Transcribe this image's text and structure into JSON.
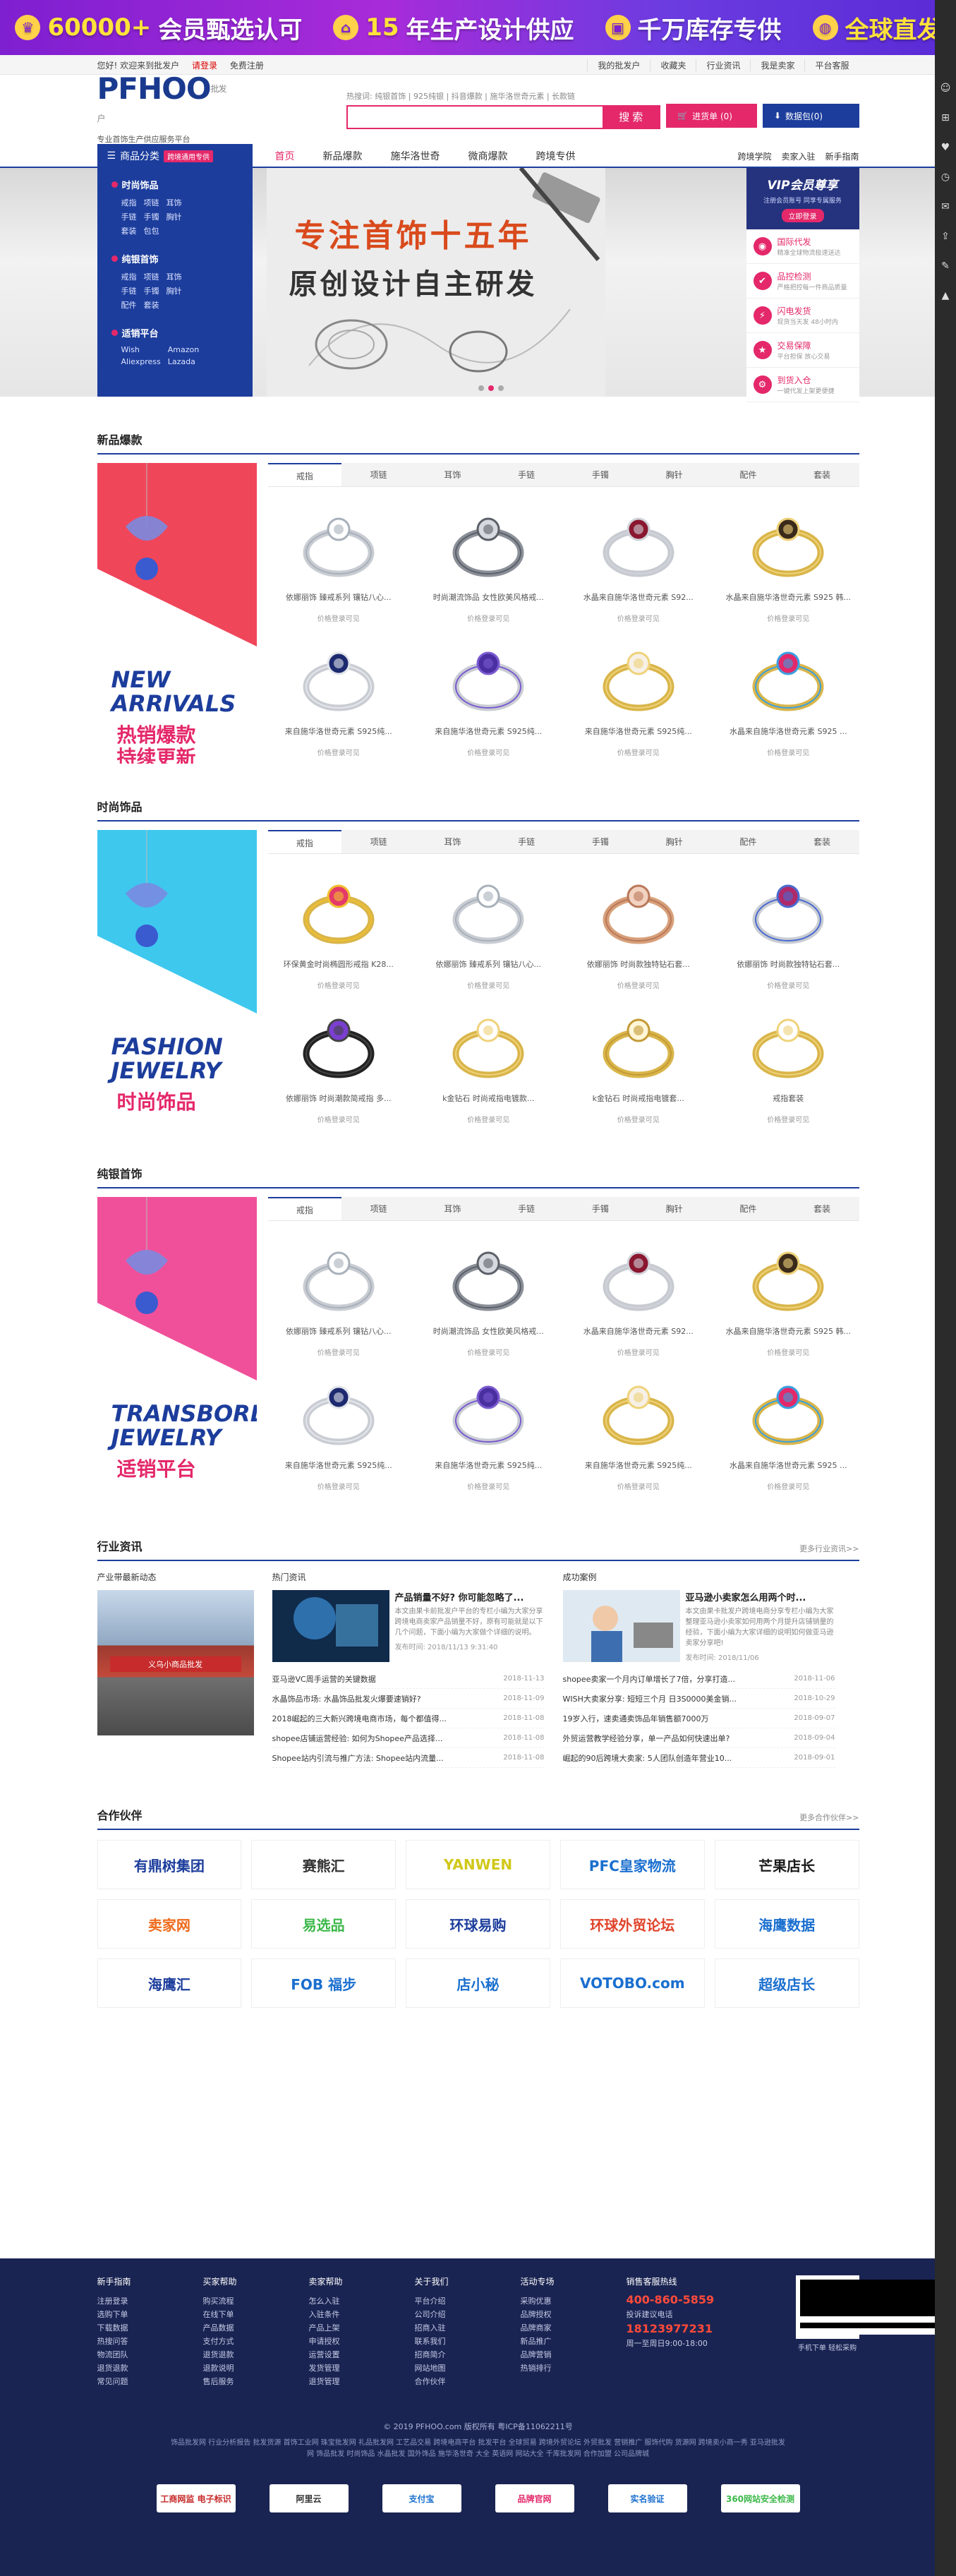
{
  "topbanner": {
    "items": [
      {
        "pre": "",
        "num": "60000+",
        "text": "会员甄选认可"
      },
      {
        "pre": "",
        "num": "15",
        "text": "年生产设计供应"
      },
      {
        "pre": "",
        "num": "",
        "text": "千万库存专供"
      },
      {
        "pre": "",
        "num": "",
        "text": "全球直发"
      }
    ]
  },
  "util": {
    "greeting": "您好! 欢迎来到批发户",
    "login": "请登录",
    "register": "免费注册",
    "right": [
      "我的批发户",
      "收藏夹",
      "行业资讯",
      "我是卖家",
      "平台客服"
    ]
  },
  "logo": {
    "main": "PFHOO",
    "cn": "批发户",
    "com": ".com",
    "sub": "专业首饰生产供应服务平台"
  },
  "search": {
    "hot": "热搜词: 纯银首饰 | 925纯银 | 抖音爆款 | 施华洛世奇元素 | 长款链",
    "placeholder": "",
    "button": "搜 索",
    "cart": "进货单 (0)",
    "data": "数据包(0)"
  },
  "nav": {
    "cat_label": "商品分类",
    "cat_tag": "跨境通用专供",
    "items": [
      "首页",
      "新品爆款",
      "施华洛世奇",
      "微商爆款",
      "跨境专供"
    ],
    "right": [
      "跨境学院",
      "卖家入驻",
      "新手指南"
    ]
  },
  "catmenu": [
    {
      "title": "时尚饰品",
      "links": [
        "戒指",
        "项链",
        "耳饰",
        "手链",
        "手镯",
        "胸针",
        "套装",
        "包包"
      ]
    },
    {
      "title": "纯银首饰",
      "links": [
        "戒指",
        "项链",
        "耳饰",
        "手链",
        "手镯",
        "胸针",
        "配件",
        "套装"
      ]
    },
    {
      "title": "适销平台",
      "links": [
        "Wish",
        "Amazon",
        "Aliexpress",
        "Lazada"
      ]
    }
  ],
  "hero": {
    "line1": "专注首饰十五年",
    "line2": "原创设计自主研发"
  },
  "vip": {
    "title": "VIP会员尊享",
    "sub": "注册会员账号 同享专属服务",
    "btn": "立即登录",
    "items": [
      {
        "icon": "globe-icon",
        "glyph": "◉",
        "title": "国际代发",
        "desc": "精准全球物流极速送达"
      },
      {
        "icon": "shield-icon",
        "glyph": "✔",
        "title": "品控检测",
        "desc": "严格把控每一件商品质量"
      },
      {
        "icon": "bolt-icon",
        "glyph": "⚡",
        "title": "闪电发货",
        "desc": "现货当天发 48小时内"
      },
      {
        "icon": "star-icon",
        "glyph": "★",
        "title": "交易保障",
        "desc": "平台担保 放心交易"
      },
      {
        "icon": "tool-icon",
        "glyph": "⚙",
        "title": "到货入仓",
        "desc": "一键代发上架更便捷"
      }
    ]
  },
  "sections": [
    {
      "title": "新品爆款",
      "promo": {
        "line1": "NEW\nARRIVALS",
        "line2": "热销爆款\n持续更新",
        "bg1": "#ffffff",
        "bg2": "#f0465a",
        "accent": "#e4286a"
      },
      "tabs": [
        "戒指",
        "项链",
        "耳饰",
        "手链",
        "手镯",
        "胸针",
        "配件",
        "套装"
      ],
      "products": [
        {
          "name": "依娜丽饰 臻戒系列 镶钻八心...",
          "price": "价格登录可见",
          "kind": "silver-cz"
        },
        {
          "name": "时尚潮流饰品 女性欧美风格戒...",
          "price": "价格登录可见",
          "kind": "silver-band"
        },
        {
          "name": "水晶来自施华洛世奇元素 S92...",
          "price": "价格登录可见",
          "kind": "ruby"
        },
        {
          "name": "水晶来自施华洛世奇元素 S925 韩...",
          "price": "价格登录可见",
          "kind": "gold-open"
        },
        {
          "name": "来自施华洛世奇元素 S925纯...",
          "price": "价格登录可见",
          "kind": "silver-pair"
        },
        {
          "name": "来自施华洛世奇元素 S925纯...",
          "price": "价格登录可见",
          "kind": "purple-flower"
        },
        {
          "name": "来自施华洛世奇元素 S925纯...",
          "price": "价格登录可见",
          "kind": "gold-pearl"
        },
        {
          "name": "水晶来自施华洛世奇元素 S925 ...",
          "price": "价格登录可见",
          "kind": "rainbow"
        }
      ]
    },
    {
      "title": "时尚饰品",
      "promo": {
        "line1": "FASHION\nJEWELRY",
        "line2": "时尚饰品",
        "bg1": "#ffffff",
        "bg2": "#3ec8ee",
        "accent": "#e4286a"
      },
      "tabs": [
        "戒指",
        "项链",
        "耳饰",
        "手链",
        "手镯",
        "胸针",
        "配件",
        "套装"
      ],
      "products": [
        {
          "name": "环保黄金时尚椭圆形戒指 K28...",
          "price": "价格登录可见",
          "kind": "multi-color"
        },
        {
          "name": "依娜丽饰 臻戒系列 镶钻八心...",
          "price": "价格登录可见",
          "kind": "silver-cz"
        },
        {
          "name": "依娜丽饰 时尚款独特钻石套...",
          "price": "价格登录可见",
          "kind": "rosegold-set"
        },
        {
          "name": "依娜丽饰 时尚款独特钻石套...",
          "price": "价格登录可见",
          "kind": "color-set"
        },
        {
          "name": "依娜丽饰 时尚潮款简戒指 多...",
          "price": "价格登录可见",
          "kind": "purple-black"
        },
        {
          "name": "k金钻石 时尚戒指电镀款...",
          "price": "价格登录可见",
          "kind": "gold-halo"
        },
        {
          "name": "k金钻石 时尚戒指电镀套...",
          "price": "价格登录可见",
          "kind": "gold-eternity"
        },
        {
          "name": "戒指套装",
          "price": "价格登录可见",
          "kind": "gold-solitaire"
        }
      ]
    },
    {
      "title": "纯银首饰",
      "promo": {
        "line1": "TRANSBORDER\nJEWELRY",
        "line2": "适销平台",
        "bg1": "#ffffff",
        "bg2": "#f0509a",
        "accent": "#e4286a"
      },
      "tabs": [
        "戒指",
        "项链",
        "耳饰",
        "手链",
        "手镯",
        "胸针",
        "配件",
        "套装"
      ],
      "products": [
        {
          "name": "依娜丽饰 臻戒系列 镶钻八心...",
          "price": "价格登录可见",
          "kind": "silver-cz"
        },
        {
          "name": "时尚潮流饰品 女性欧美风格戒...",
          "price": "价格登录可见",
          "kind": "silver-band"
        },
        {
          "name": "水晶来自施华洛世奇元素 S92...",
          "price": "价格登录可见",
          "kind": "ruby"
        },
        {
          "name": "水晶来自施华洛世奇元素 S925 韩...",
          "price": "价格登录可见",
          "kind": "gold-open"
        },
        {
          "name": "来自施华洛世奇元素 S925纯...",
          "price": "价格登录可见",
          "kind": "silver-pair"
        },
        {
          "name": "来自施华洛世奇元素 S925纯...",
          "price": "价格登录可见",
          "kind": "purple-flower"
        },
        {
          "name": "来自施华洛世奇元素 S925纯...",
          "price": "价格登录可见",
          "kind": "gold-pearl"
        },
        {
          "name": "水晶来自施华洛世奇元素 S925 ...",
          "price": "价格登录可见",
          "kind": "rainbow"
        }
      ]
    }
  ],
  "news": {
    "title": "行业资讯",
    "more": "更多行业资讯>>",
    "col1": {
      "h": "产业带最新动态",
      "sign": "义乌小商品批发"
    },
    "col2": {
      "h": "热门资讯",
      "feat": {
        "title": "产品销量不好? 你可能忽略了...",
        "desc": "本文由果卡前批发户平台的专栏小编为大家分享跨境电商卖家产品销量不好，原有可能就是以下几个问题，下面小编为大家做个详细的说明。",
        "date": "发布时间: 2018/11/13 9:31:40"
      },
      "list": [
        {
          "t": "亚马逊VC周手运营的关键数据",
          "d": "2018-11-13"
        },
        {
          "t": "水晶饰品市场: 水晶饰品批发火爆要速销好?",
          "d": "2018-11-09"
        },
        {
          "t": "2018崛起的三大新兴跨境电商市场，每个都值得...",
          "d": "2018-11-08"
        },
        {
          "t": "shopee店铺运营经验: 如何为Shopee产品选择...",
          "d": "2018-11-08"
        },
        {
          "t": "Shopee站内引流与推广方法: Shopee站内流量...",
          "d": "2018-11-08"
        }
      ]
    },
    "col3": {
      "h": "成功案例",
      "feat": {
        "title": "亚马逊小卖家怎么用两个时...",
        "desc": "本文由果卡批发户跨境电商分享专栏小编为大家整理亚马逊小卖家如何用两个月提升店铺销量的经验，下面小编为大家详细的说明如何做亚马逊卖家分享吧!",
        "date": "发布时间: 2018/11/06"
      },
      "list": [
        {
          "t": "shopee卖家一个月内订单增长了7倍，分享打造...",
          "d": "2018-11-06"
        },
        {
          "t": "WISH大卖家分享: 短短三个月 日3S0000美金销...",
          "d": "2018-10-29"
        },
        {
          "t": "19岁入行，速卖通卖饰品年销售额7000万",
          "d": "2018-09-07"
        },
        {
          "t": "外贸运营教学经验分享，单一产品如何快速出单?",
          "d": "2018-09-04"
        },
        {
          "t": "崛起的90后跨境大卖家: 5人团队创造年营业10...",
          "d": "2018-09-01"
        }
      ]
    }
  },
  "partners": {
    "title": "合作伙伴",
    "more": "更多合作伙伴>>",
    "items": [
      {
        "name": "有鼎树集团",
        "c": "#1c3d9c"
      },
      {
        "name": "赛熊汇",
        "c": "#333333"
      },
      {
        "name": "YANWEN",
        "c": "#d1c81a"
      },
      {
        "name": "PFC皇家物流",
        "c": "#1a6fcf"
      },
      {
        "name": "芒果店长",
        "c": "#1a1a1a"
      },
      {
        "name": "卖家网",
        "c": "#ef6a1a"
      },
      {
        "name": "易选品",
        "c": "#3cb84a"
      },
      {
        "name": "环球易购",
        "c": "#1c3d9c"
      },
      {
        "name": "环球外贸论坛",
        "c": "#e0432a"
      },
      {
        "name": "海鹰数据",
        "c": "#1a6fcf"
      },
      {
        "name": "海鹰汇",
        "c": "#1c3d9c"
      },
      {
        "name": "FOB 福步",
        "c": "#1a6fcf"
      },
      {
        "name": "店小秘",
        "c": "#1a6fcf"
      },
      {
        "name": "VOTOBO.com",
        "c": "#1a6fcf"
      },
      {
        "name": "超级店长",
        "c": "#1a6fcf"
      }
    ]
  },
  "footer": {
    "cols": [
      {
        "h": "新手指南",
        "items": [
          "注册登录",
          "选购下单",
          "下载数据",
          "热搜问答",
          "物流团队",
          "退货退款",
          "常见问题"
        ]
      },
      {
        "h": "买家帮助",
        "items": [
          "购买流程",
          "在线下单",
          "产品数据",
          "支付方式",
          "退货退款",
          "退款说明",
          "售后服务"
        ]
      },
      {
        "h": "卖家帮助",
        "items": [
          "怎么入驻",
          "入驻条件",
          "产品上架",
          "申请授权",
          "运营设置",
          "发货管理",
          "退货管理"
        ]
      },
      {
        "h": "关于我们",
        "items": [
          "平台介绍",
          "公司介绍",
          "招商入驻",
          "联系我们",
          "招商简介",
          "网站地图",
          "合作伙伴"
        ]
      },
      {
        "h": "活动专场",
        "items": [
          "采购优惠",
          "品牌授权",
          "品牌商家",
          "新品推广",
          "品牌营销",
          "热销排行"
        ]
      }
    ],
    "contact": {
      "h": "销售客服热线",
      "phone": "400-860-5859",
      "email_h": "投诉建议电话",
      "phone2": "18123977231",
      "hours": "周一至周日9:00-18:00"
    },
    "qr_text": "手机下单 轻松采购",
    "copy": "© 2019 PFHOO.com 版权所有 粤ICP备11062211号",
    "links": "饰品批发网 行业分析报告 批发货源 首饰工业网 珠宝批发网 礼品批发网 工艺品交易 跨境电商平台 批发平台 全球贸易 跨境外贸论坛 外贸批发 营销推广 服饰代购 货源网 跨境卖小商一秀 亚马逊批发网 饰品批发 时尚饰品 水晶批发 国外饰品 施华洛世奇 大全 英语网 网站大全 千库批发网 合作加盟 公司品牌城",
    "badges": [
      {
        "name": "工商网监 电子标识",
        "c": "#c62828"
      },
      {
        "name": "阿里云",
        "c": "#333333"
      },
      {
        "name": "支付宝",
        "c": "#1a6fcf"
      },
      {
        "name": "品牌官网",
        "c": "#e4286a"
      },
      {
        "name": "实名验证",
        "c": "#1a6fcf"
      },
      {
        "name": "360网站安全检测",
        "c": "#3cb84a"
      }
    ]
  },
  "rside": [
    "user-icon",
    "cart-icon",
    "heart-icon",
    "clock-icon",
    "chat-icon",
    "share-icon",
    "edit-icon",
    "top-icon"
  ],
  "colors": {
    "brand_blue": "#1c3d9c",
    "brand_pink": "#e4286a",
    "footer_bg": "#1a2452"
  }
}
